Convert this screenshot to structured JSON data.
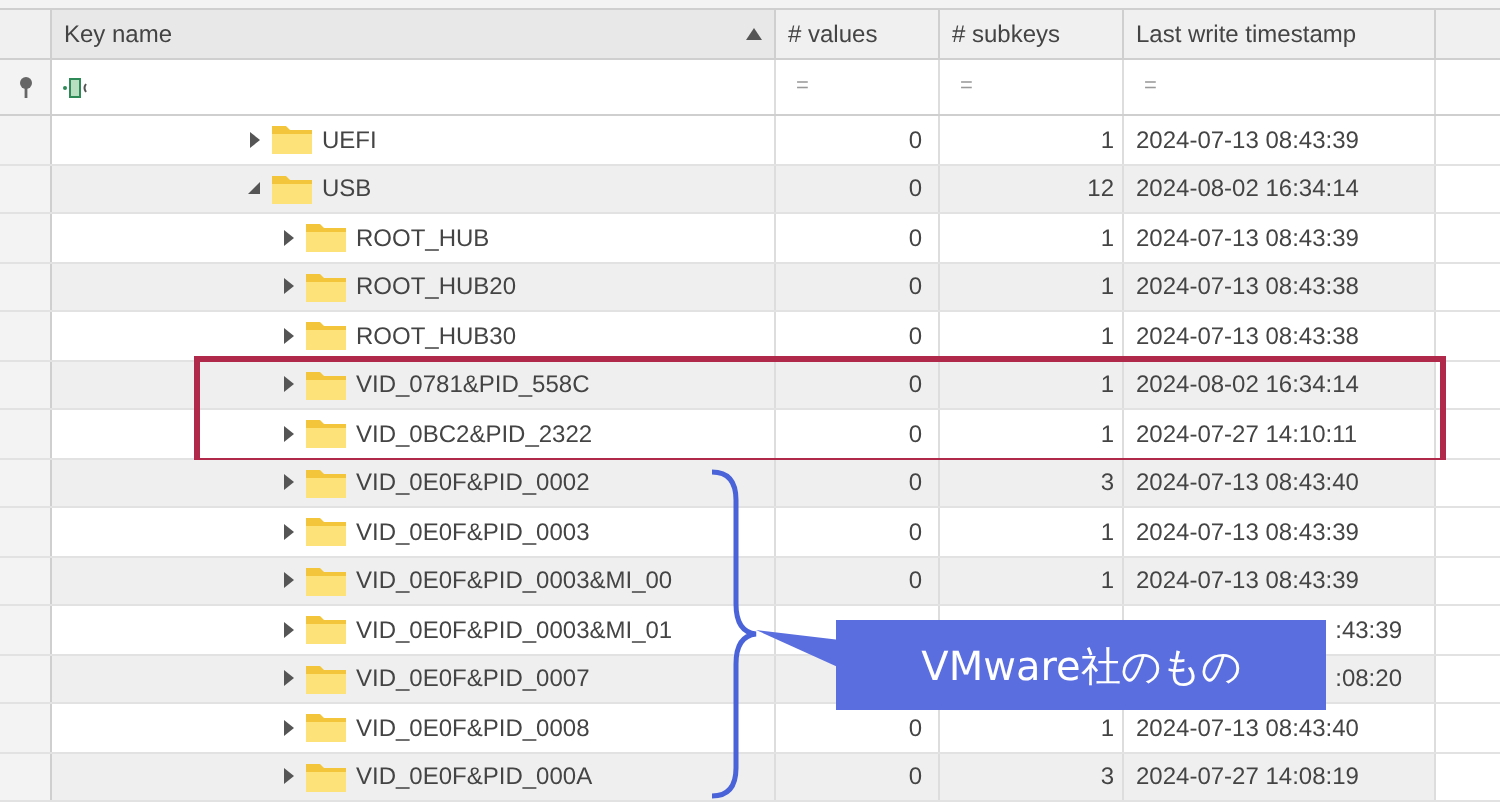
{
  "table": {
    "columns": [
      {
        "label": "Key name",
        "sorted": true
      },
      {
        "label": "# values",
        "sorted": false
      },
      {
        "label": "# subkeys",
        "sorted": false
      },
      {
        "label": "Last write timestamp",
        "sorted": false
      }
    ],
    "filter": {
      "operators": [
        "=",
        "=",
        "="
      ]
    },
    "rows": [
      {
        "name": "UEFI",
        "expanded": false,
        "values": "0",
        "subkeys": "1",
        "timestamp": "2024-07-13 08:43:39"
      },
      {
        "name": "USB",
        "expanded": true,
        "values": "0",
        "subkeys": "12",
        "timestamp": "2024-08-02 16:34:14",
        "children": [
          {
            "name": "ROOT_HUB",
            "expanded": false,
            "values": "0",
            "subkeys": "1",
            "timestamp": "2024-07-13 08:43:39"
          },
          {
            "name": "ROOT_HUB20",
            "expanded": false,
            "values": "0",
            "subkeys": "1",
            "timestamp": "2024-07-13 08:43:38"
          },
          {
            "name": "ROOT_HUB30",
            "expanded": false,
            "values": "0",
            "subkeys": "1",
            "timestamp": "2024-07-13 08:43:38"
          },
          {
            "name": "VID_0781&PID_558C",
            "expanded": false,
            "values": "0",
            "subkeys": "1",
            "timestamp": "2024-08-02 16:34:14",
            "highlighted": true
          },
          {
            "name": "VID_0BC2&PID_2322",
            "expanded": false,
            "values": "0",
            "subkeys": "1",
            "timestamp": "2024-07-27 14:10:11",
            "highlighted": true
          },
          {
            "name": "VID_0E0F&PID_0002",
            "expanded": false,
            "values": "0",
            "subkeys": "3",
            "timestamp": "2024-07-13 08:43:40"
          },
          {
            "name": "VID_0E0F&PID_0003",
            "expanded": false,
            "values": "0",
            "subkeys": "1",
            "timestamp": "2024-07-13 08:43:39"
          },
          {
            "name": "VID_0E0F&PID_0003&MI_00",
            "expanded": false,
            "values": "0",
            "subkeys": "1",
            "timestamp": "2024-07-13 08:43:39"
          },
          {
            "name": "VID_0E0F&PID_0003&MI_01",
            "expanded": false,
            "kind": "covered",
            "timestamp": ":43:39"
          },
          {
            "name": "VID_0E0F&PID_0007",
            "expanded": false,
            "kind": "covered",
            "timestamp": ":08:20"
          },
          {
            "name": "VID_0E0F&PID_0008",
            "expanded": false,
            "values": "0",
            "subkeys": "1",
            "timestamp": "2024-07-13 08:43:40"
          },
          {
            "name": "VID_0E0F&PID_000A",
            "expanded": false,
            "values": "0",
            "subkeys": "3",
            "timestamp": "2024-07-27 14:08:19"
          }
        ]
      }
    ]
  },
  "callout": {
    "text": "VMware社のもの"
  }
}
